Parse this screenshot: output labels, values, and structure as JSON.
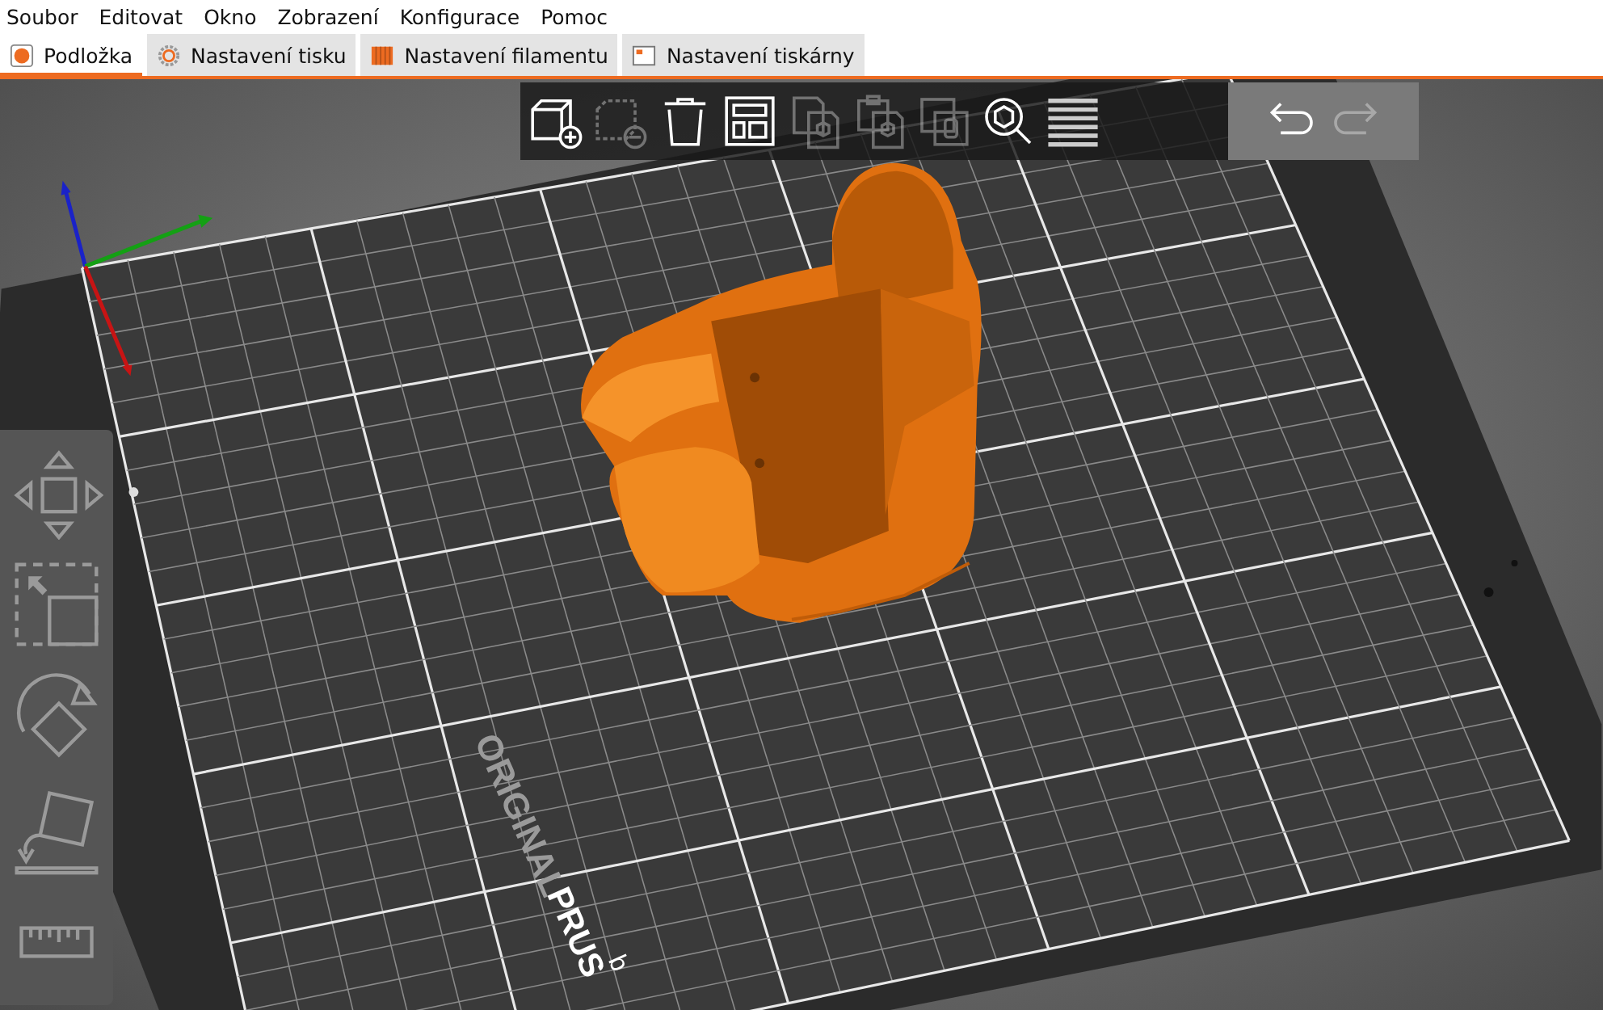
{
  "menu": [
    "Soubor",
    "Editovat",
    "Okno",
    "Zobrazení",
    "Konfigurace",
    "Pomoc"
  ],
  "tabs": [
    {
      "label": "Podložka",
      "kind": "plater",
      "selected": true
    },
    {
      "label": "Nastavení tisku",
      "kind": "print",
      "selected": false
    },
    {
      "label": "Nastavení filamentu",
      "kind": "filament",
      "selected": false
    },
    {
      "label": "Nastavení tiskárny",
      "kind": "printer",
      "selected": false
    }
  ],
  "top_toolbar": [
    {
      "kind": "add",
      "disabled": false
    },
    {
      "kind": "delete",
      "disabled": true
    },
    {
      "kind": "delete-all",
      "disabled": false
    },
    {
      "kind": "arrange",
      "disabled": false
    },
    {
      "kind": "copy",
      "disabled": true
    },
    {
      "kind": "paste",
      "disabled": true
    },
    {
      "kind": "instance",
      "disabled": true
    },
    {
      "kind": "search",
      "disabled": false
    },
    {
      "kind": "layers",
      "disabled": false
    },
    {
      "kind": "undo",
      "disabled": false
    },
    {
      "kind": "redo",
      "disabled": true
    }
  ],
  "left_toolbar": [
    {
      "kind": "move"
    },
    {
      "kind": "scale"
    },
    {
      "kind": "rotate"
    },
    {
      "kind": "place-on-face"
    },
    {
      "kind": "measure"
    }
  ],
  "bed": {
    "labels": [
      {
        "text": "ORIGINAL",
        "kind": "dim"
      },
      {
        "text": "PRUS",
        "kind": "bright"
      },
      {
        "text": "b",
        "kind": "small"
      }
    ]
  }
}
